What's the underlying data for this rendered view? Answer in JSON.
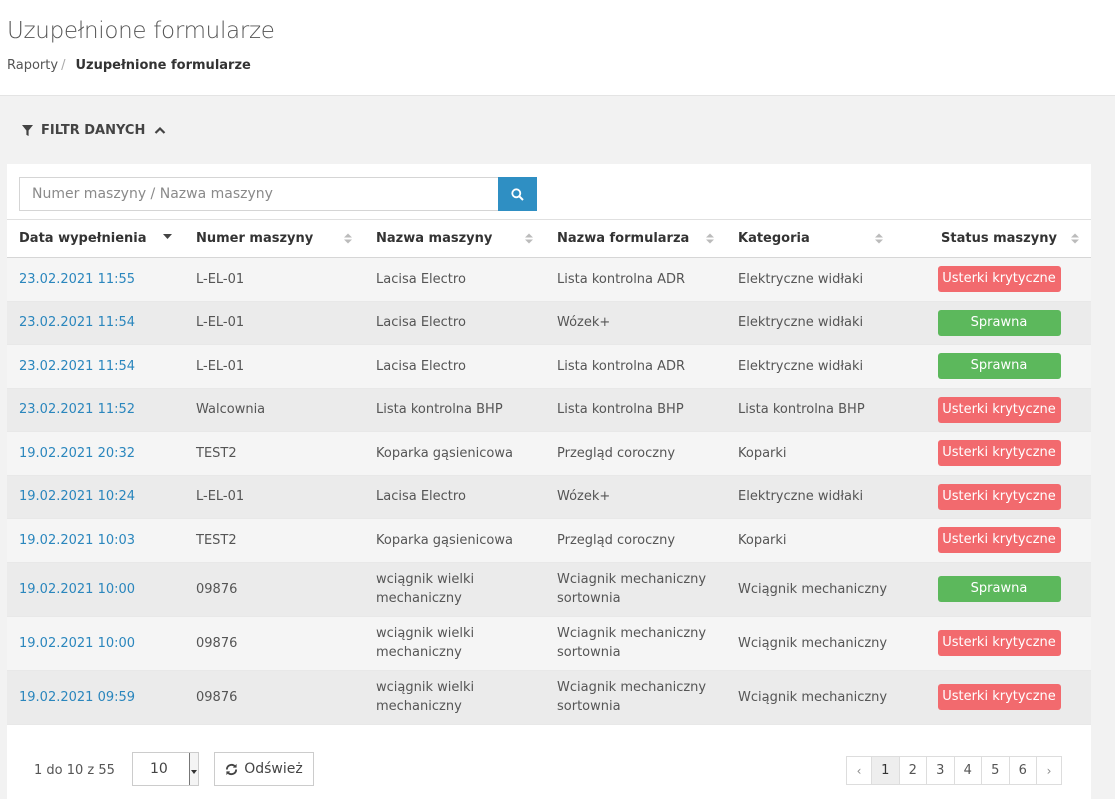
{
  "header": {
    "title": "Uzupełnione formularze",
    "breadcrumb": {
      "parent": "Raporty",
      "separator": "/",
      "current": "Uzupełnione formularze"
    }
  },
  "filter": {
    "label": "FILTR DANYCH",
    "icon": "filter-icon",
    "toggle_icon": "chevron-up-icon"
  },
  "search": {
    "placeholder": "Numer maszyny / Nazwa maszyny",
    "value": "",
    "button_icon": "search-icon"
  },
  "table": {
    "columns": [
      "Data wypełnienia",
      "Numer maszyny",
      "Nazwa maszyny",
      "Nazwa formularza",
      "Kategoria",
      "Status maszyny"
    ],
    "rows": [
      {
        "date": "23.02.2021 11:55",
        "number": "L-EL-01",
        "machine": "Lacisa Electro",
        "form": "Lista kontrolna ADR",
        "category": "Elektryczne widłaki",
        "status": "Usterki krytyczne",
        "status_color": "#f26a6e"
      },
      {
        "date": "23.02.2021 11:54",
        "number": "L-EL-01",
        "machine": "Lacisa Electro",
        "form": "Wózek+",
        "category": "Elektryczne widłaki",
        "status": "Sprawna",
        "status_color": "#5cb85c"
      },
      {
        "date": "23.02.2021 11:54",
        "number": "L-EL-01",
        "machine": "Lacisa Electro",
        "form": "Lista kontrolna ADR",
        "category": "Elektryczne widłaki",
        "status": "Sprawna",
        "status_color": "#5cb85c"
      },
      {
        "date": "23.02.2021 11:52",
        "number": "Walcownia",
        "machine": "Lista kontrolna BHP",
        "form": "Lista kontrolna BHP",
        "category": "Lista kontrolna BHP",
        "status": "Usterki krytyczne",
        "status_color": "#f26a6e"
      },
      {
        "date": "19.02.2021 20:32",
        "number": "TEST2",
        "machine": "Koparka gąsienicowa",
        "form": "Przegląd coroczny",
        "category": "Koparki",
        "status": "Usterki krytyczne",
        "status_color": "#f26a6e"
      },
      {
        "date": "19.02.2021 10:24",
        "number": "L-EL-01",
        "machine": "Lacisa Electro",
        "form": "Wózek+",
        "category": "Elektryczne widłaki",
        "status": "Usterki krytyczne",
        "status_color": "#f26a6e"
      },
      {
        "date": "19.02.2021 10:03",
        "number": "TEST2",
        "machine": "Koparka gąsienicowa",
        "form": "Przegląd coroczny",
        "category": "Koparki",
        "status": "Usterki krytyczne",
        "status_color": "#f26a6e"
      },
      {
        "date": "19.02.2021 10:00",
        "number": "09876",
        "machine": "wciągnik wielki mechaniczny",
        "form": "Wciagnik mechaniczny sortownia",
        "category": "Wciągnik mechaniczny",
        "status": "Sprawna",
        "status_color": "#5cb85c"
      },
      {
        "date": "19.02.2021 10:00",
        "number": "09876",
        "machine": "wciągnik wielki mechaniczny",
        "form": "Wciagnik mechaniczny sortownia",
        "category": "Wciągnik mechaniczny",
        "status": "Usterki krytyczne",
        "status_color": "#f26a6e"
      },
      {
        "date": "19.02.2021 09:59",
        "number": "09876",
        "machine": "wciągnik wielki mechaniczny",
        "form": "Wciagnik mechaniczny sortownia",
        "category": "Wciągnik mechaniczny",
        "status": "Usterki krytyczne",
        "status_color": "#f26a6e"
      }
    ]
  },
  "footer": {
    "info": "1 do 10 z 55",
    "page_size": "10",
    "refresh_label": "Odśwież",
    "pages": [
      "1",
      "2",
      "3",
      "4",
      "5",
      "6"
    ],
    "active_page": "1",
    "prev": "‹",
    "next": "›"
  }
}
